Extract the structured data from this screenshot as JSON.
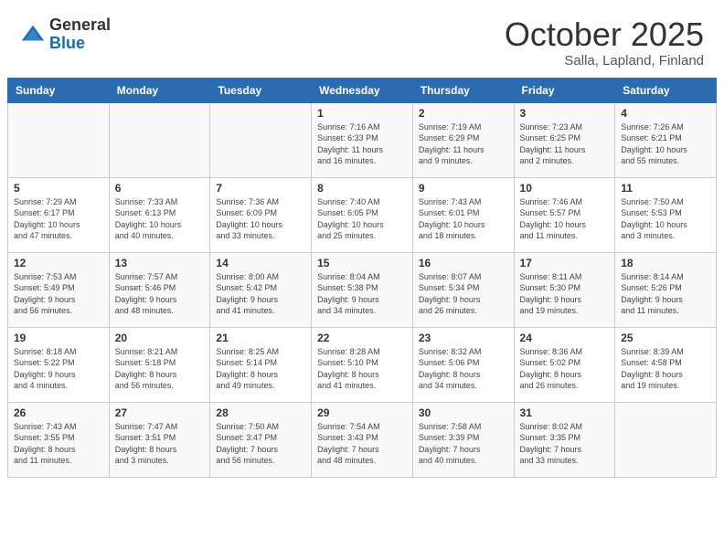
{
  "header": {
    "logo_general": "General",
    "logo_blue": "Blue",
    "month": "October 2025",
    "location": "Salla, Lapland, Finland"
  },
  "days_of_week": [
    "Sunday",
    "Monday",
    "Tuesday",
    "Wednesday",
    "Thursday",
    "Friday",
    "Saturday"
  ],
  "weeks": [
    [
      {
        "day": "",
        "info": ""
      },
      {
        "day": "",
        "info": ""
      },
      {
        "day": "",
        "info": ""
      },
      {
        "day": "1",
        "info": "Sunrise: 7:16 AM\nSunset: 6:33 PM\nDaylight: 11 hours\nand 16 minutes."
      },
      {
        "day": "2",
        "info": "Sunrise: 7:19 AM\nSunset: 6:29 PM\nDaylight: 11 hours\nand 9 minutes."
      },
      {
        "day": "3",
        "info": "Sunrise: 7:23 AM\nSunset: 6:25 PM\nDaylight: 11 hours\nand 2 minutes."
      },
      {
        "day": "4",
        "info": "Sunrise: 7:26 AM\nSunset: 6:21 PM\nDaylight: 10 hours\nand 55 minutes."
      }
    ],
    [
      {
        "day": "5",
        "info": "Sunrise: 7:29 AM\nSunset: 6:17 PM\nDaylight: 10 hours\nand 47 minutes."
      },
      {
        "day": "6",
        "info": "Sunrise: 7:33 AM\nSunset: 6:13 PM\nDaylight: 10 hours\nand 40 minutes."
      },
      {
        "day": "7",
        "info": "Sunrise: 7:36 AM\nSunset: 6:09 PM\nDaylight: 10 hours\nand 33 minutes."
      },
      {
        "day": "8",
        "info": "Sunrise: 7:40 AM\nSunset: 6:05 PM\nDaylight: 10 hours\nand 25 minutes."
      },
      {
        "day": "9",
        "info": "Sunrise: 7:43 AM\nSunset: 6:01 PM\nDaylight: 10 hours\nand 18 minutes."
      },
      {
        "day": "10",
        "info": "Sunrise: 7:46 AM\nSunset: 5:57 PM\nDaylight: 10 hours\nand 11 minutes."
      },
      {
        "day": "11",
        "info": "Sunrise: 7:50 AM\nSunset: 5:53 PM\nDaylight: 10 hours\nand 3 minutes."
      }
    ],
    [
      {
        "day": "12",
        "info": "Sunrise: 7:53 AM\nSunset: 5:49 PM\nDaylight: 9 hours\nand 56 minutes."
      },
      {
        "day": "13",
        "info": "Sunrise: 7:57 AM\nSunset: 5:46 PM\nDaylight: 9 hours\nand 48 minutes."
      },
      {
        "day": "14",
        "info": "Sunrise: 8:00 AM\nSunset: 5:42 PM\nDaylight: 9 hours\nand 41 minutes."
      },
      {
        "day": "15",
        "info": "Sunrise: 8:04 AM\nSunset: 5:38 PM\nDaylight: 9 hours\nand 34 minutes."
      },
      {
        "day": "16",
        "info": "Sunrise: 8:07 AM\nSunset: 5:34 PM\nDaylight: 9 hours\nand 26 minutes."
      },
      {
        "day": "17",
        "info": "Sunrise: 8:11 AM\nSunset: 5:30 PM\nDaylight: 9 hours\nand 19 minutes."
      },
      {
        "day": "18",
        "info": "Sunrise: 8:14 AM\nSunset: 5:26 PM\nDaylight: 9 hours\nand 11 minutes."
      }
    ],
    [
      {
        "day": "19",
        "info": "Sunrise: 8:18 AM\nSunset: 5:22 PM\nDaylight: 9 hours\nand 4 minutes."
      },
      {
        "day": "20",
        "info": "Sunrise: 8:21 AM\nSunset: 5:18 PM\nDaylight: 8 hours\nand 56 minutes."
      },
      {
        "day": "21",
        "info": "Sunrise: 8:25 AM\nSunset: 5:14 PM\nDaylight: 8 hours\nand 49 minutes."
      },
      {
        "day": "22",
        "info": "Sunrise: 8:28 AM\nSunset: 5:10 PM\nDaylight: 8 hours\nand 41 minutes."
      },
      {
        "day": "23",
        "info": "Sunrise: 8:32 AM\nSunset: 5:06 PM\nDaylight: 8 hours\nand 34 minutes."
      },
      {
        "day": "24",
        "info": "Sunrise: 8:36 AM\nSunset: 5:02 PM\nDaylight: 8 hours\nand 26 minutes."
      },
      {
        "day": "25",
        "info": "Sunrise: 8:39 AM\nSunset: 4:58 PM\nDaylight: 8 hours\nand 19 minutes."
      }
    ],
    [
      {
        "day": "26",
        "info": "Sunrise: 7:43 AM\nSunset: 3:55 PM\nDaylight: 8 hours\nand 11 minutes."
      },
      {
        "day": "27",
        "info": "Sunrise: 7:47 AM\nSunset: 3:51 PM\nDaylight: 8 hours\nand 3 minutes."
      },
      {
        "day": "28",
        "info": "Sunrise: 7:50 AM\nSunset: 3:47 PM\nDaylight: 7 hours\nand 56 minutes."
      },
      {
        "day": "29",
        "info": "Sunrise: 7:54 AM\nSunset: 3:43 PM\nDaylight: 7 hours\nand 48 minutes."
      },
      {
        "day": "30",
        "info": "Sunrise: 7:58 AM\nSunset: 3:39 PM\nDaylight: 7 hours\nand 40 minutes."
      },
      {
        "day": "31",
        "info": "Sunrise: 8:02 AM\nSunset: 3:35 PM\nDaylight: 7 hours\nand 33 minutes."
      },
      {
        "day": "",
        "info": ""
      }
    ]
  ]
}
